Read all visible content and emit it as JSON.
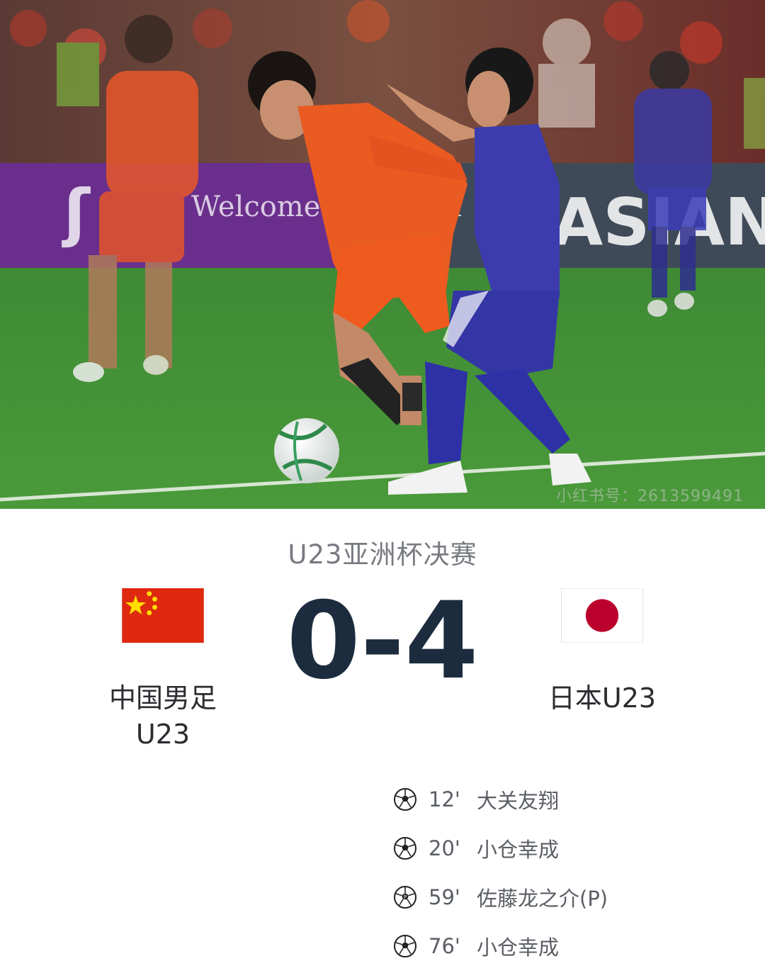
{
  "photo": {
    "banner_text": "Welcome to Arabia",
    "banner_right_text": "ASIAN",
    "watermark": "小红书号：2613599491"
  },
  "match": {
    "title": "U23亚洲杯决赛",
    "score": "0-4",
    "home_team": "中国男足\nU23",
    "away_team": "日本U23",
    "home_flag": "china-flag-icon",
    "away_flag": "japan-flag-icon"
  },
  "goals": [
    {
      "minute": "12'",
      "scorer": "大关友翔"
    },
    {
      "minute": "20'",
      "scorer": "小仓幸成"
    },
    {
      "minute": "59'",
      "scorer": "佐藤龙之介(P)"
    },
    {
      "minute": "76'",
      "scorer": "小仓幸成"
    }
  ],
  "colors": {
    "china_red": "#de2910",
    "china_yellow": "#ffde00",
    "japan_red": "#bc002d",
    "score_navy": "#1c2c3e",
    "title_gray": "#777a80"
  }
}
